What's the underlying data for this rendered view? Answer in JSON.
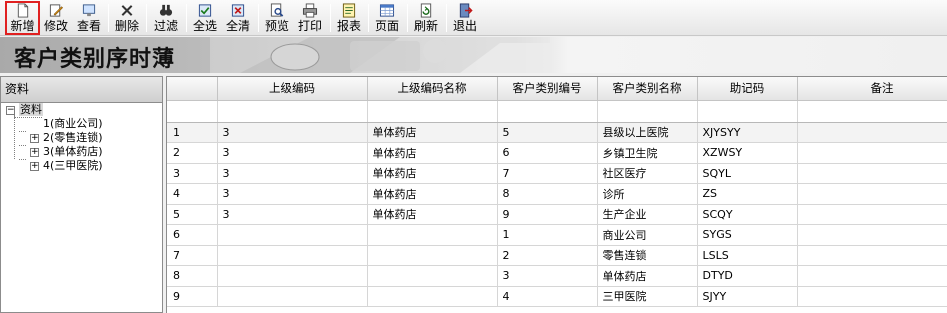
{
  "toolbar": {
    "buttons": [
      {
        "label": "新增",
        "icon": "new-doc-icon"
      },
      {
        "label": "修改",
        "icon": "edit-icon"
      },
      {
        "label": "查看",
        "icon": "view-icon"
      },
      {
        "label": "删除",
        "icon": "delete-icon"
      },
      {
        "label": "过滤",
        "icon": "binoculars-icon"
      },
      {
        "label": "全选",
        "icon": "select-all-icon"
      },
      {
        "label": "全清",
        "icon": "clear-all-icon"
      },
      {
        "label": "预览",
        "icon": "preview-icon"
      },
      {
        "label": "打印",
        "icon": "print-icon"
      },
      {
        "label": "报表",
        "icon": "report-icon"
      },
      {
        "label": "页面",
        "icon": "page-icon"
      },
      {
        "label": "刷新",
        "icon": "refresh-icon"
      },
      {
        "label": "退出",
        "icon": "exit-icon"
      }
    ]
  },
  "banner": {
    "title": "客户类别序时薄"
  },
  "left_pane": {
    "header": "资料",
    "tree": {
      "root": "资料",
      "children": [
        "1(商业公司)",
        "2(零售连锁)",
        "3(单体药店)",
        "4(三甲医院)"
      ]
    }
  },
  "grid": {
    "columns": [
      "上级编码",
      "上级编码名称",
      "客户类别编号",
      "客户类别名称",
      "助记码",
      "备注"
    ],
    "rows": [
      {
        "n": "1",
        "parent_code": "3",
        "parent_name": "单体药店",
        "code": "5",
        "name": "县级以上医院",
        "mnemonic": "XJYSYY",
        "remark": ""
      },
      {
        "n": "2",
        "parent_code": "3",
        "parent_name": "单体药店",
        "code": "6",
        "name": "乡镇卫生院",
        "mnemonic": "XZWSY",
        "remark": ""
      },
      {
        "n": "3",
        "parent_code": "3",
        "parent_name": "单体药店",
        "code": "7",
        "name": "社区医疗",
        "mnemonic": "SQYL",
        "remark": ""
      },
      {
        "n": "4",
        "parent_code": "3",
        "parent_name": "单体药店",
        "code": "8",
        "name": "诊所",
        "mnemonic": "ZS",
        "remark": ""
      },
      {
        "n": "5",
        "parent_code": "3",
        "parent_name": "单体药店",
        "code": "9",
        "name": "生产企业",
        "mnemonic": "SCQY",
        "remark": ""
      },
      {
        "n": "6",
        "parent_code": "",
        "parent_name": "",
        "code": "1",
        "name": "商业公司",
        "mnemonic": "SYGS",
        "remark": ""
      },
      {
        "n": "7",
        "parent_code": "",
        "parent_name": "",
        "code": "2",
        "name": "零售连锁",
        "mnemonic": "LSLS",
        "remark": ""
      },
      {
        "n": "8",
        "parent_code": "",
        "parent_name": "",
        "code": "3",
        "name": "单体药店",
        "mnemonic": "DTYD",
        "remark": ""
      },
      {
        "n": "9",
        "parent_code": "",
        "parent_name": "",
        "code": "4",
        "name": "三甲医院",
        "mnemonic": "SJYY",
        "remark": ""
      }
    ]
  },
  "colors": {
    "highlight": "#e02020",
    "banner_dark": "#a9a9a9"
  }
}
